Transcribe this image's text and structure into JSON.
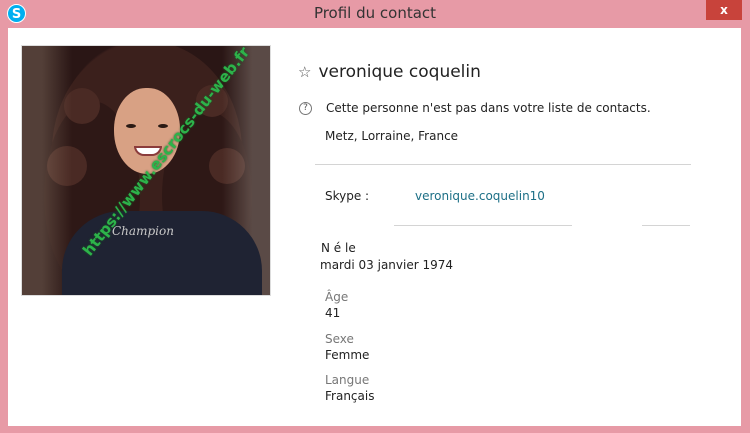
{
  "window": {
    "title": "Profil du contact",
    "app_icon": "S",
    "close_icon": "x"
  },
  "photo": {
    "watermark": "https://www.escrocs-du-web.fr",
    "shirt_text": "Champion"
  },
  "profile": {
    "name": "veronique coquelin",
    "notice": "Cette personne n'est pas dans votre liste de contacts.",
    "location": "Metz, Lorraine, France",
    "skype_label": "Skype :",
    "skype_id": "veronique.coquelin10",
    "birth_label": "N é le",
    "birth_value": "mardi 03 janvier 1974",
    "age_label": "Âge",
    "age_value": "41",
    "sex_label": "Sexe",
    "sex_value": "Femme",
    "language_label": "Langue",
    "language_value": "Français"
  },
  "icons": {
    "star": "star-outline-icon",
    "help": "question-circle-icon"
  },
  "colors": {
    "frame": "#e79aa6",
    "close_button": "#c8433b",
    "skype_link": "#1c6f86",
    "watermark": "#2db34a"
  }
}
